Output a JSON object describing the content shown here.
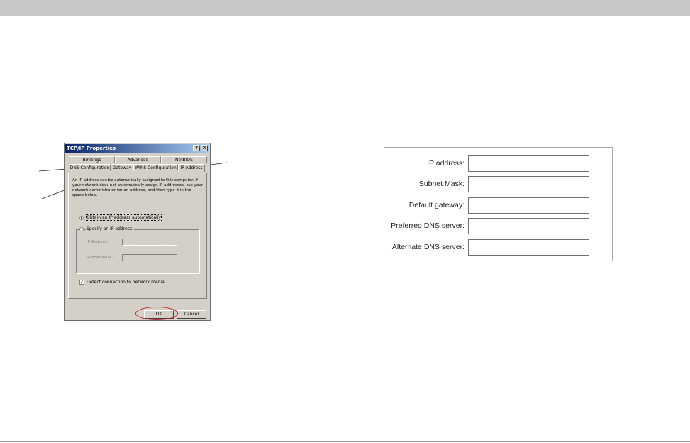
{
  "dialog": {
    "title": "TCP/IP Properties",
    "help_button": "?",
    "close_button": "×",
    "tabs_back": [
      "Bindings",
      "Advanced",
      "NetBIOS"
    ],
    "tabs_front": [
      "DNS Configuration",
      "Gateway",
      "WINS Configuration",
      "IP Address"
    ],
    "active_tab": "IP Address",
    "description": "An IP address can be automatically assigned to this computer. If your network does not automatically assign IP addresses, ask your network administrator for an address, and then type it in the space below.",
    "option_auto": "Obtain an IP address automatically",
    "option_specify": "Specify an IP address:",
    "ip_address_label": "IP Address:",
    "subnet_mask_label": "Subnet Mask:",
    "detect_label": "Detect connection to network media",
    "ok_label": "OK",
    "cancel_label": "Cancel"
  },
  "ip_form": {
    "rows": [
      {
        "label": "IP address:",
        "value": ""
      },
      {
        "label": "Subnet Mask:",
        "value": ""
      },
      {
        "label": "Default gateway:",
        "value": ""
      },
      {
        "label": "Preferred DNS server:",
        "value": ""
      },
      {
        "label": "Alternate DNS server:",
        "value": ""
      }
    ]
  },
  "colors": {
    "top_bar": "#c6c7c9",
    "dialog_face": "#d4d0c8",
    "title_gradient_start": "#0a246a",
    "highlight_ring": "#c8202a"
  }
}
